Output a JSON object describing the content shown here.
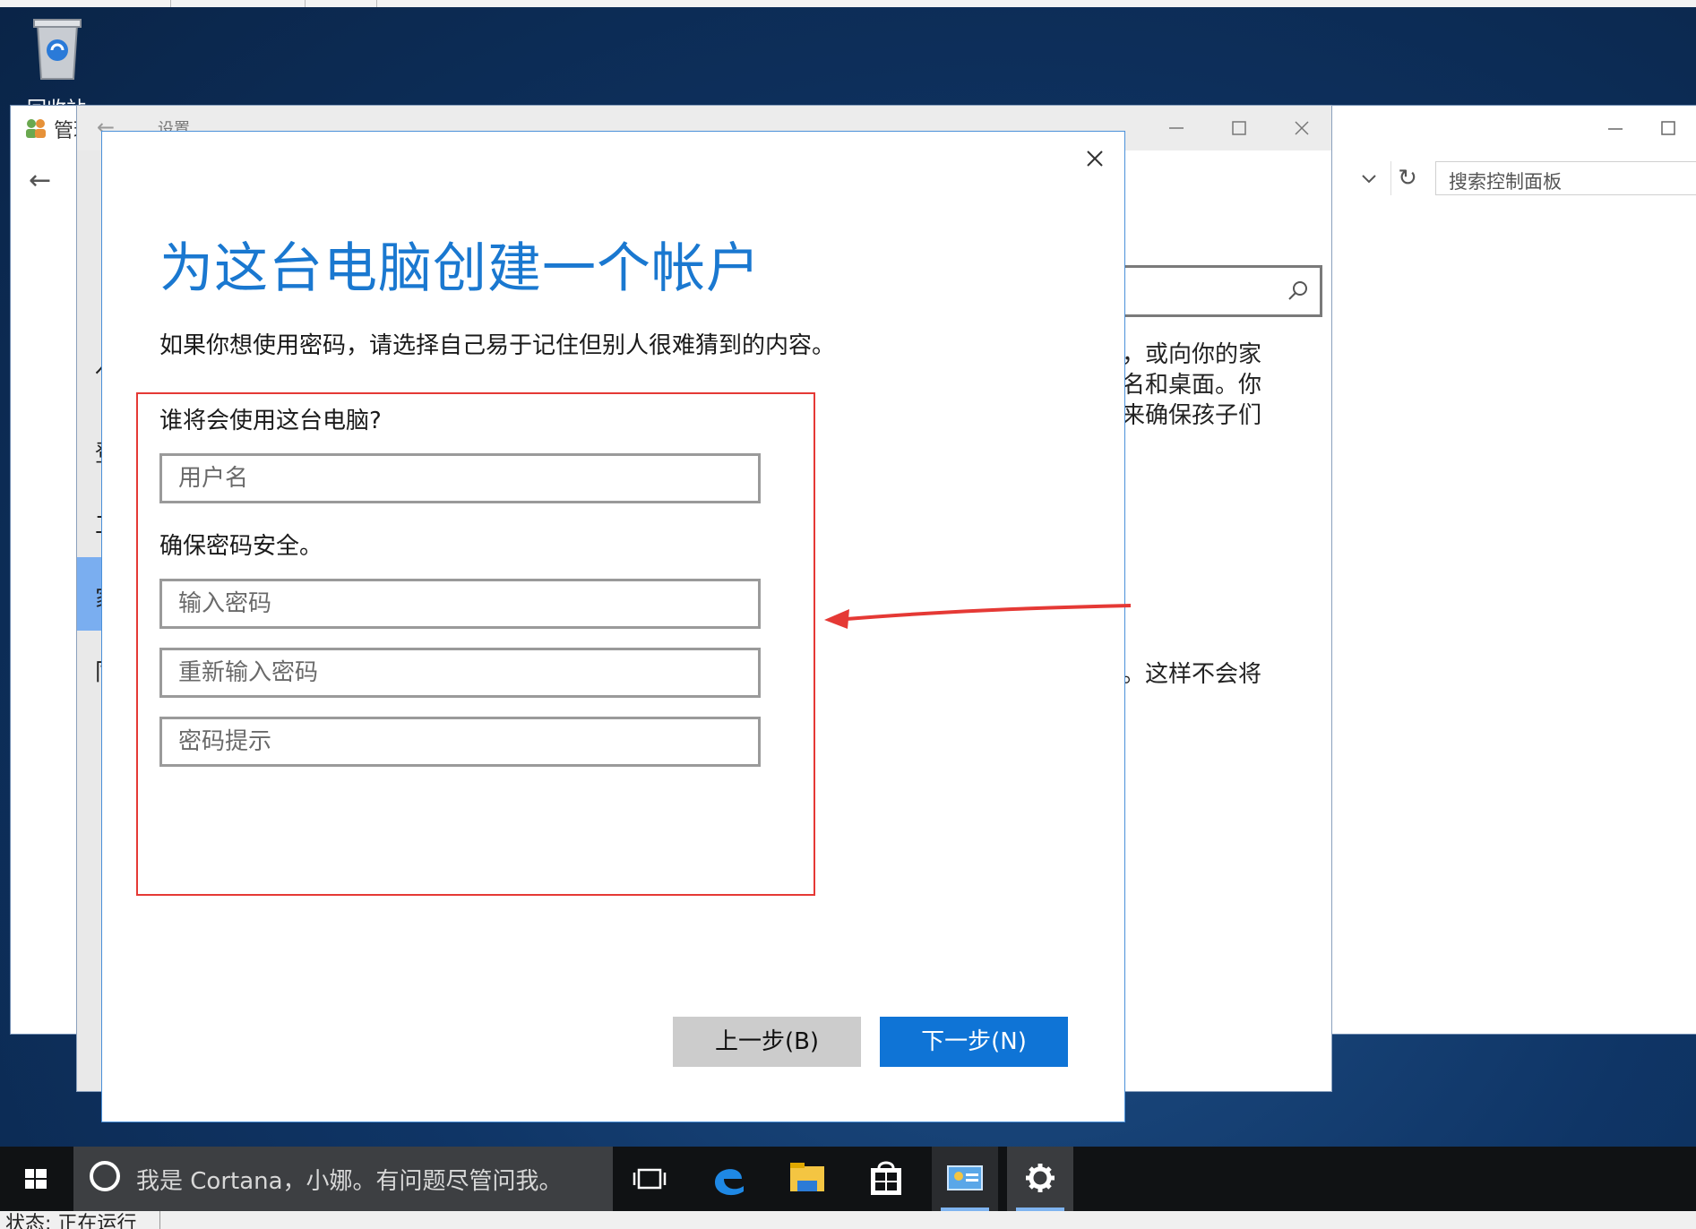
{
  "desktop": {
    "recycle_bin_label": "回收站"
  },
  "control_panel": {
    "title": "管理",
    "search_placeholder": "搜索控制面板"
  },
  "settings": {
    "title": "设置",
    "left_chars": [
      "亻",
      "登",
      "工",
      "家",
      "同"
    ],
    "bg_lines": [
      "庭，或向你的家",
      "录名和桌面。你",
      "我来确保孩子们",
      "录。这样不会将"
    ]
  },
  "dialog": {
    "heading": "为这台电脑创建一个帐户",
    "description": "如果你想使用密码，请选择自己易于记住但别人很难猜到的内容。",
    "who_label": "谁将会使用这台电脑?",
    "username_placeholder": "用户名",
    "secure_label": "确保密码安全。",
    "password_placeholder": "输入密码",
    "reenter_placeholder": "重新输入密码",
    "hint_placeholder": "密码提示",
    "back_button": "上一步(B)",
    "next_button": "下一步(N)"
  },
  "taskbar": {
    "cortana_text": "我是 Cortana，小娜。有问题尽管问我。",
    "icons": [
      "task-view-icon",
      "edge-icon",
      "file-explorer-icon",
      "store-icon",
      "control-panel-icon",
      "settings-gear-icon"
    ]
  },
  "statusbar": {
    "text": "状态: 正在运行"
  },
  "colors": {
    "accent": "#1a78d0",
    "next_button": "#0f74d6",
    "annotation_red": "#e53935",
    "taskbar": "#101214"
  }
}
